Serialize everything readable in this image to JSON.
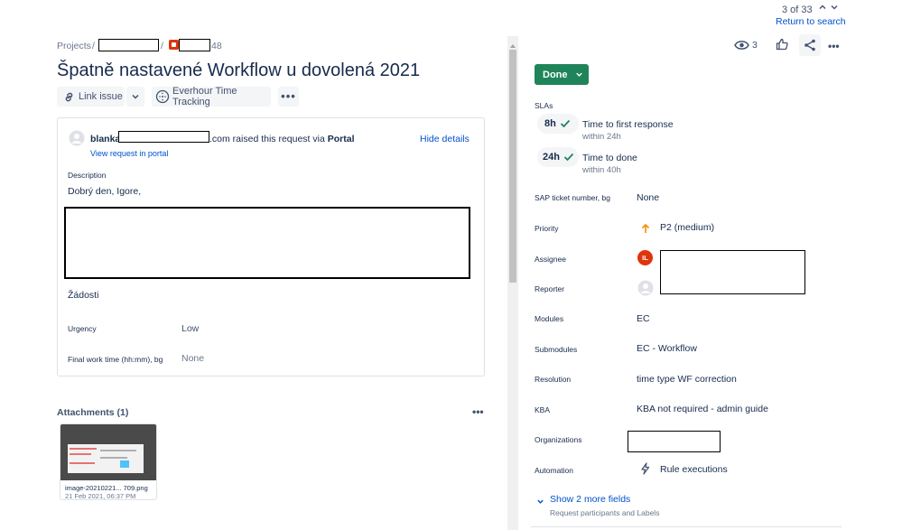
{
  "pager": {
    "count": "3 of 33",
    "return_link": "Return to search"
  },
  "breadcrumb": {
    "projects": "Projects",
    "sep1": "/",
    "sep2": "/",
    "issue_suffix": "48"
  },
  "issue": {
    "title": "Špatně nastavené Workflow u dovolená 2021"
  },
  "actions": {
    "link_issue": "Link issue",
    "everhour": "Everhour Time Tracking"
  },
  "request": {
    "user_prefix": "blanka",
    "user_suffix": ".com",
    "raised_text": " raised this request via ",
    "portal": "Portal",
    "hide_details": "Hide details",
    "view_in_portal": "View request in portal"
  },
  "description": {
    "label": "Description",
    "greeting": "Dobrý den, Igore,",
    "zadosti": "Žádosti"
  },
  "details": [
    {
      "label": "Urgency",
      "value": "Low"
    },
    {
      "label": "Final work time (hh:mm), bg",
      "value": "None"
    }
  ],
  "attachments": {
    "header": "Attachments (1)",
    "file_name": "image-20210221... 709.png",
    "file_date": "21 Feb 2021, 06:37 PM"
  },
  "top_right": {
    "watch_count": "3"
  },
  "status": {
    "label": "Done"
  },
  "slas": {
    "label": "SLAs",
    "items": [
      {
        "badge": "8h",
        "title": "Time to first response",
        "sub": "within 24h"
      },
      {
        "badge": "24h",
        "title": "Time to done",
        "sub": "within 40h"
      }
    ]
  },
  "fields": {
    "sap": {
      "label": "SAP ticket number, bg",
      "value": "None"
    },
    "priority": {
      "label": "Priority",
      "value": "P2 (medium)"
    },
    "assignee": {
      "label": "Assignee",
      "initials": "IL"
    },
    "reporter": {
      "label": "Reporter"
    },
    "modules": {
      "label": "Modules",
      "value": "EC"
    },
    "submodules": {
      "label": "Submodules",
      "value": "EC - Workflow"
    },
    "resolution": {
      "label": "Resolution",
      "value": "time type WF correction"
    },
    "kba": {
      "label": "KBA",
      "value": "KBA not required - admin guide"
    },
    "organizations": {
      "label": "Organizations"
    },
    "automation": {
      "label": "Automation",
      "value": "Rule executions"
    }
  },
  "more_fields": {
    "label": "Show 2 more fields",
    "sub": "Request participants and Labels"
  },
  "colors": {
    "done": "#1f845a",
    "link": "#0052cc",
    "priority": "#ff8b00",
    "avatar": "#de350b"
  }
}
